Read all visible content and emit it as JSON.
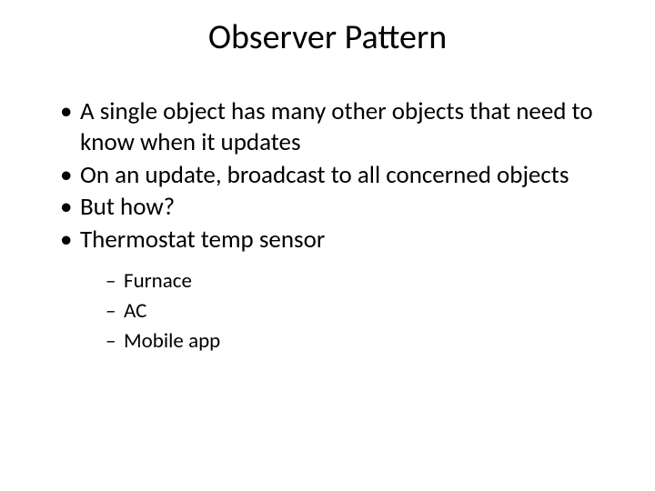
{
  "title": "Observer Pattern",
  "bullets": [
    "A single object has many other objects that need to know when it updates",
    "On an update, broadcast to all concerned objects",
    "But how?",
    "Thermostat temp sensor"
  ],
  "sub_bullets": [
    "Furnace",
    "AC",
    "Mobile app"
  ]
}
